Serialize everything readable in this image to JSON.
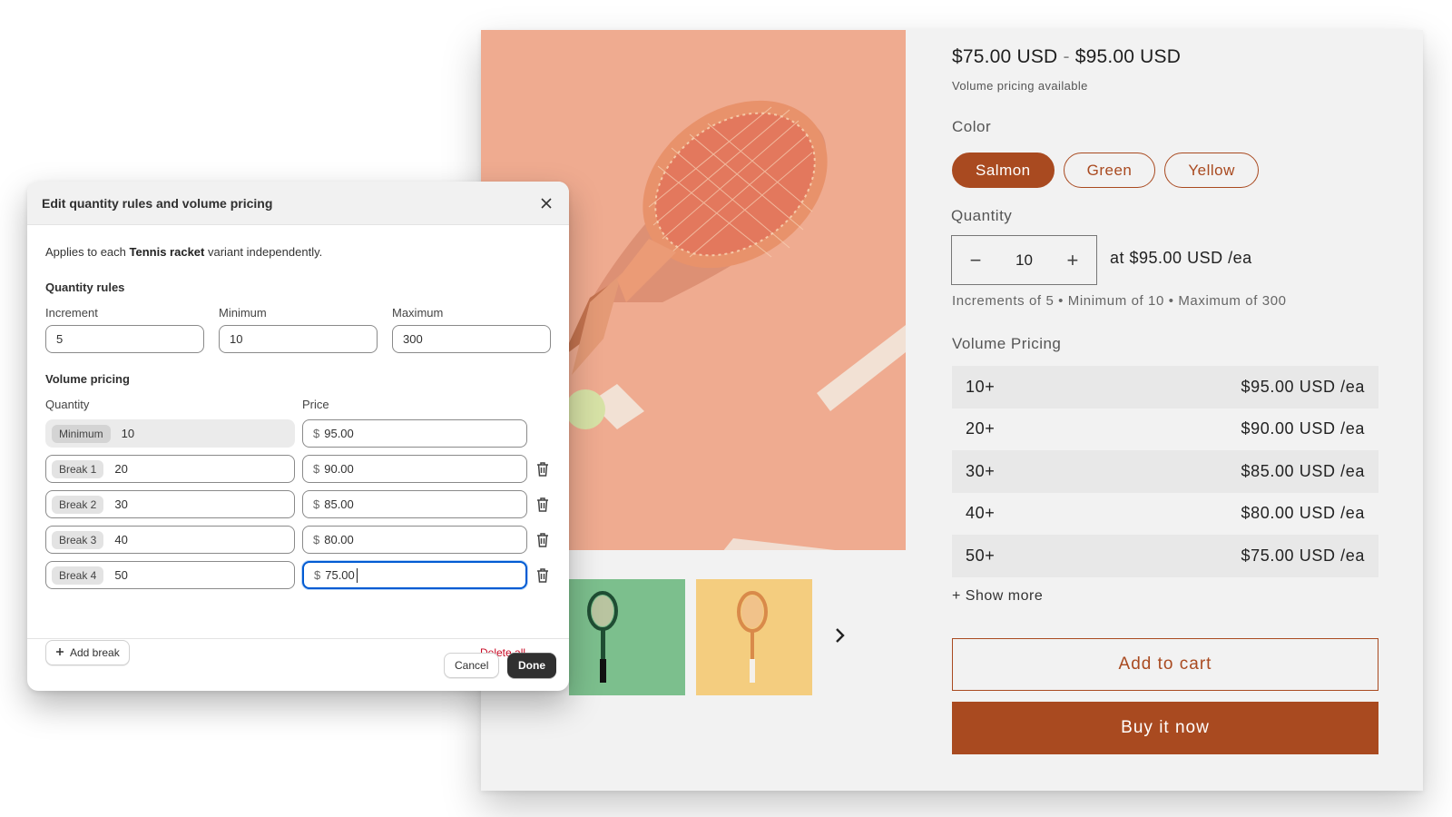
{
  "product": {
    "price_low": "$75.00 USD",
    "price_dash": "-",
    "price_high": "$95.00 USD",
    "volume_note": "Volume pricing available",
    "color_label": "Color",
    "colors": [
      "Salmon",
      "Green",
      "Yellow"
    ],
    "selected_color": "Salmon",
    "quantity_label": "Quantity",
    "quantity_value": "10",
    "quantity_decrement": "−",
    "quantity_increment": "+",
    "at_price": "at  $95.00 USD /ea",
    "quantity_rules": "Increments of 5 • Minimum of 10 • Maximum of 300",
    "volume_pricing_title": "Volume Pricing",
    "volume_pricing": [
      {
        "qty": "10+",
        "price": "$95.00 USD /ea"
      },
      {
        "qty": "20+",
        "price": "$90.00 USD /ea"
      },
      {
        "qty": "30+",
        "price": "$85.00 USD /ea"
      },
      {
        "qty": "40+",
        "price": "$80.00 USD /ea"
      },
      {
        "qty": "50+",
        "price": "$75.00 USD /ea"
      }
    ],
    "show_more": "+ Show more",
    "add_to_cart": "Add to cart",
    "buy_now": "Buy it now",
    "accent_color": "#a94a20",
    "image_color": "#efab90"
  },
  "modal": {
    "title": "Edit quantity rules and volume pricing",
    "applies_prefix": "Applies to each ",
    "applies_product": "Tennis racket",
    "applies_suffix": " variant independently.",
    "quantity_rules_title": "Quantity rules",
    "increment_label": "Increment",
    "increment_value": "5",
    "minimum_label": "Minimum",
    "minimum_value": "10",
    "maximum_label": "Maximum",
    "maximum_value": "300",
    "volume_pricing_title": "Volume pricing",
    "quantity_col": "Quantity",
    "price_col": "Price",
    "currency_symbol": "$",
    "rows": [
      {
        "tag": "Minimum",
        "qty": "10",
        "price": "95.00"
      },
      {
        "tag": "Break 1",
        "qty": "20",
        "price": "90.00"
      },
      {
        "tag": "Break 2",
        "qty": "30",
        "price": "85.00"
      },
      {
        "tag": "Break 3",
        "qty": "40",
        "price": "80.00"
      },
      {
        "tag": "Break 4",
        "qty": "50",
        "price": "75.00"
      }
    ],
    "add_break": "Add break",
    "delete_all": "Delete all",
    "cancel": "Cancel",
    "done": "Done",
    "focus_color": "#005bd3",
    "critical_color": "#c70a24"
  }
}
